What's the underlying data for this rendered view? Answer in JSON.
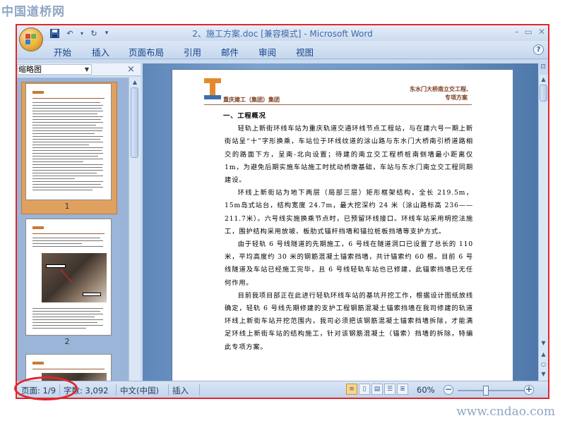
{
  "watermark": {
    "site_name": "中国道桥网",
    "url": "www.cndao.com"
  },
  "window": {
    "title": "2、施工方案.doc [兼容模式] - Microsoft Word",
    "controls": [
      "minimize",
      "restore",
      "close"
    ]
  },
  "quick_access": {
    "save": "save-icon",
    "undo": "undo-icon",
    "redo": "redo-icon",
    "customize": "▾"
  },
  "ribbon": {
    "tabs": [
      "开始",
      "插入",
      "页面布局",
      "引用",
      "邮件",
      "审阅",
      "视图"
    ]
  },
  "thumbnail_pane": {
    "selector_value": "缩略图",
    "close": "×",
    "pages": [
      "1",
      "2"
    ]
  },
  "document": {
    "header_left": "重庆建工（集团）集团",
    "header_right_line1": "东水门大桥南立交工程、",
    "header_right_line2": "专项方案",
    "heading": "一、工程概况",
    "paragraphs": [
      "轻轨上新街环线车站为重庆轨道交通环线节点工程站，与在建六号一期上新街站呈“十”字形换乘，车站位于环线纹道的涂山路与东水门大桥南引桥道路相交的路面下方，呈南-北向设置；待建的南立交工程桥桩南侧墙最小距离仅 1m，为避免后期实施车站施工时扰动桥墩基础，车站与东水门南立交工程同期建设。",
      "环线上新街站为地下两层（局部三层）矩形框架结构，全长 219.5m，15m岛式站台，结构宽度 24.7m，最大挖深约 24 米（涂山路标高 236——211.7米）。六号线实施换乘节点时，已预留环线接口。环线车站采用明挖法施工，围护结构采用放坡、板肋式锚杆挡墙和锚拉桩板挡墙等支护方式。",
      "由于轻轨 6 号线隧道的先期施工，6 号线在隧道洞口已设置了总长的 110 米，平均高度约 30 米的钢筋混凝土锚索挡墙，共计锚索约 60 根。目前 6 号线隧道及车站已经施工完毕，且 6 号线轻轨车站也已修建，此锚索挡墙已无任何作用。",
      "目前我项目部正在此进行轻轨环线车站的基坑开挖工作，根据设计图纸放线确定，轻轨 6 号线先期修建的支护工程钢筋混凝土锚索挡墙在我司修建的轨道环线上新街车站开挖范围内，我司必须把该钢筋混凝土锚索挡墙拆除，才能满足环线上新街车站的结构施工，针对该钢筋混凝土（锚索）挡墙的拆除，特编此专项方案。"
    ]
  },
  "status_bar": {
    "page": "页面: 1/9",
    "words": "字数: 3,092",
    "language": "中文(中国)",
    "mode": "插入",
    "zoom": "60%",
    "zoom_minus": "−",
    "zoom_plus": "+"
  },
  "colors": {
    "highlight_red": "#e0262b",
    "ribbon_blue": "#c5d7ee",
    "doc_bg_blue": "#7da3cf",
    "thumb_selected": "#e0a160"
  }
}
